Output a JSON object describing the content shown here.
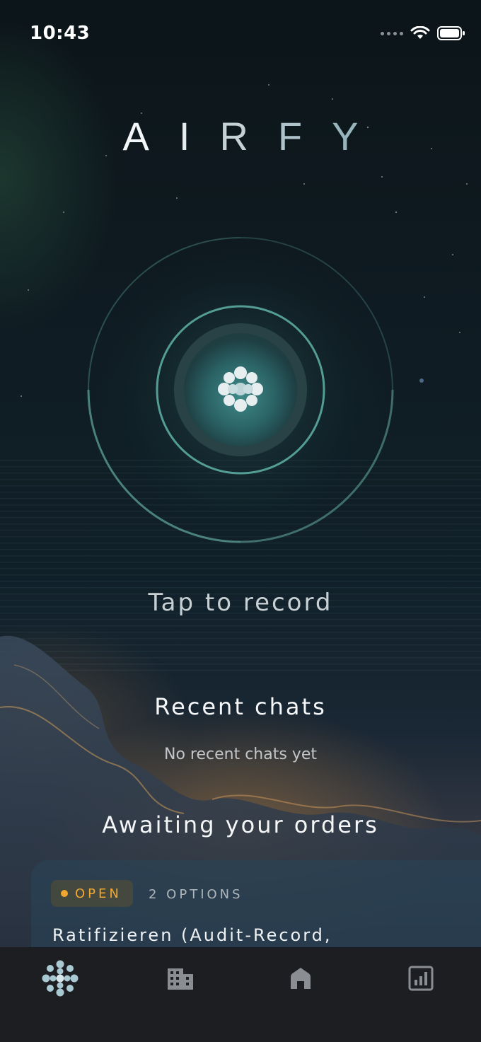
{
  "status_bar": {
    "time": "10:43",
    "wifi_icon": "wifi-icon",
    "battery_icon": "battery-icon"
  },
  "app": {
    "logo_text": "AIRFY"
  },
  "record": {
    "prompt": "Tap to record",
    "icon": "dots-flower-icon"
  },
  "recent_chats": {
    "title": "Recent chats",
    "empty_text": "No recent chats yet"
  },
  "orders": {
    "title": "Awaiting your orders",
    "cards": [
      {
        "status": "OPEN",
        "options": "2 OPTIONS",
        "title": "Ratifizieren (Audit-Record,"
      }
    ]
  },
  "tabbar": {
    "items": [
      {
        "name": "assistant",
        "icon": "dots-flower-icon",
        "active": true
      },
      {
        "name": "buildings",
        "icon": "building-icon",
        "active": false
      },
      {
        "name": "home",
        "icon": "home-icon",
        "active": false
      },
      {
        "name": "stats",
        "icon": "chart-icon",
        "active": false
      }
    ]
  },
  "colors": {
    "accent_teal": "#5fb3a8",
    "status_open": "#f0a830"
  }
}
